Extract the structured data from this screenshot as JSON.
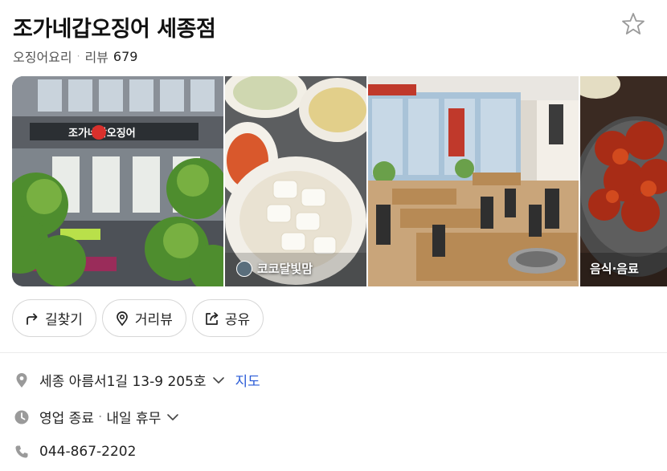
{
  "place": {
    "name": "조가네갑오징어 세종점",
    "category": "오징어요리",
    "review_label": "리뷰",
    "review_count": "679"
  },
  "photos": {
    "second_caption": "코코달빛맘",
    "fourth_caption": "음식·음료",
    "storefront_sign": "조가네갑오징어"
  },
  "actions": [
    {
      "label": "길찾기",
      "icon": "directions-icon"
    },
    {
      "label": "거리뷰",
      "icon": "location-pin-icon"
    },
    {
      "label": "공유",
      "icon": "share-icon"
    }
  ],
  "info": {
    "address": "세종 아름서1길 13-9 205호",
    "map_label": "지도",
    "hours_status": "영업 종료",
    "hours_next": "내일 휴무",
    "phone": "044-867-2202"
  },
  "colors": {
    "link": "#2a5bd7",
    "icon_gray": "#9a9a9a",
    "border": "#d6d6d6"
  }
}
